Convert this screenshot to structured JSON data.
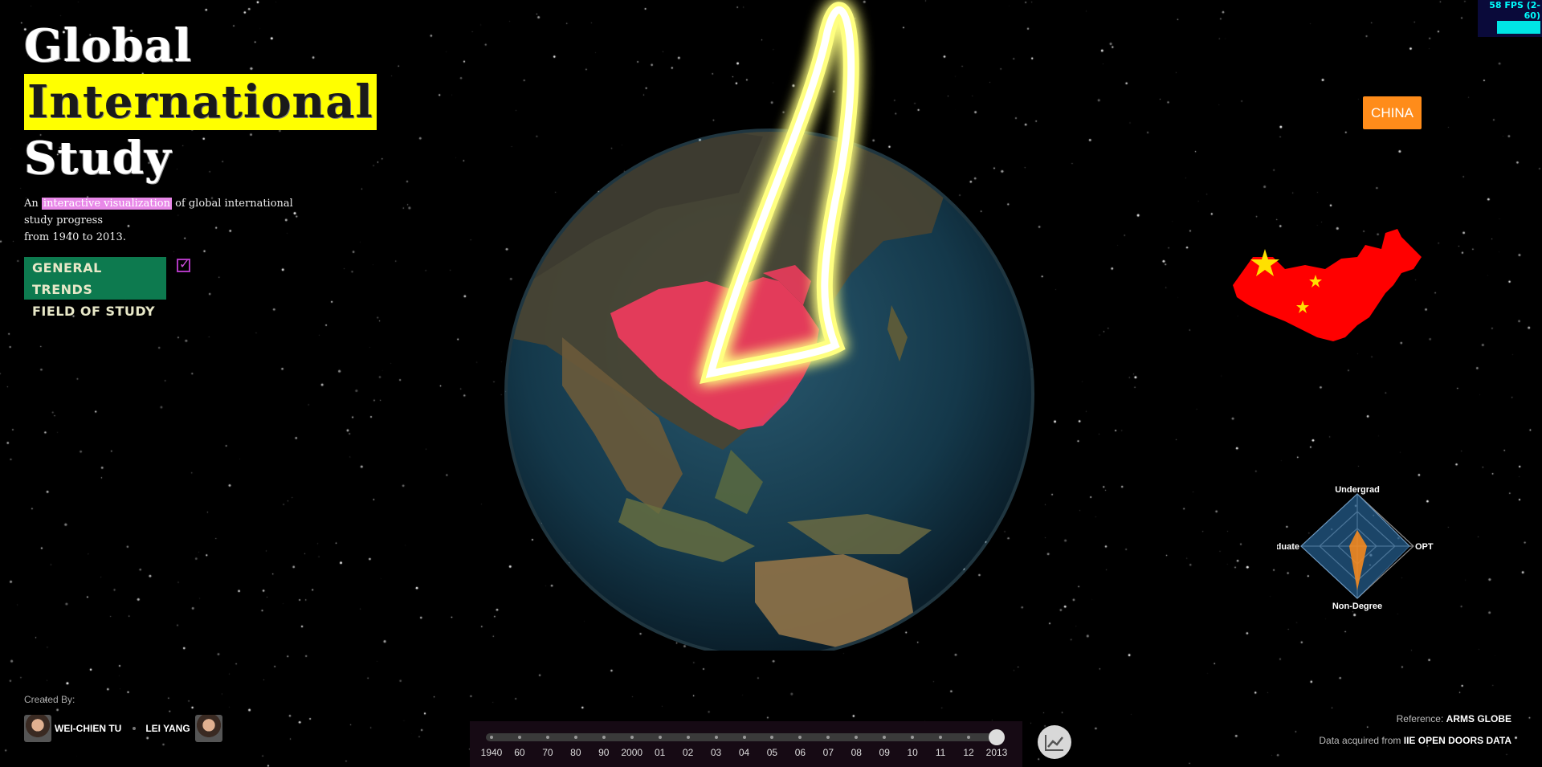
{
  "title": {
    "line1": "Global",
    "line2": "International",
    "line3": "Study"
  },
  "subtitle": {
    "pre": "An",
    "highlight": "interactive visualization",
    "post": "of global international study progress",
    "line2": "from 1940 to 2013."
  },
  "menu": {
    "items": [
      "GENERAL TRENDS",
      "FIELD OF STUDY"
    ],
    "checkbox_checked": true
  },
  "fps": {
    "text": "58 FPS (2-60)"
  },
  "country": {
    "label": "CHINA"
  },
  "radar": {
    "axes": [
      "Undergrad",
      "OPT",
      "Non-Degree",
      "Graduate"
    ]
  },
  "credits": {
    "label": "Created By:",
    "creators": [
      "WEI-CHIEN TU",
      "LEI YANG"
    ]
  },
  "timeline": {
    "years": [
      "1940",
      "60",
      "70",
      "80",
      "90",
      "2000",
      "01",
      "02",
      "03",
      "04",
      "05",
      "06",
      "07",
      "08",
      "09",
      "10",
      "11",
      "12",
      "2013"
    ],
    "selected": "2013"
  },
  "references": {
    "ref_label": "Reference:",
    "ref_value": "ARMS GLOBE",
    "data_label": "Data acquired from",
    "data_value": "IIE OPEN DOORS DATA"
  },
  "colors": {
    "highlight_yellow": "#ffff00",
    "menu_green": "#0d7a4f",
    "country_orange": "#ff8c1a",
    "china_red": "#ff2a55",
    "arc_yellow": "#ffff80"
  },
  "icons": [
    "line-chart-icon",
    "checkmark-icon",
    "china-flag-map"
  ]
}
